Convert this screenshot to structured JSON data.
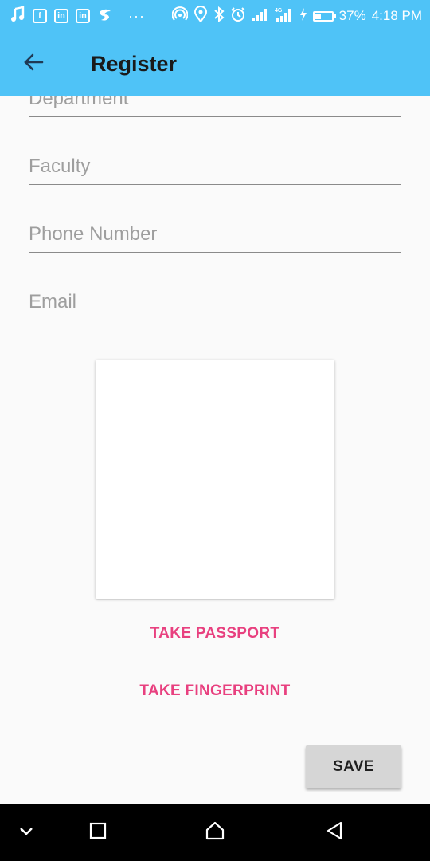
{
  "status_bar": {
    "icons_left": [
      "music-note-icon",
      "facebook-icon",
      "linkedin-icon",
      "linkedin-icon",
      "swirl-app-icon",
      "more-dots-icon"
    ],
    "icons_right": [
      "hotspot-icon",
      "location-icon",
      "bluetooth-icon",
      "alarm-icon",
      "signal-icon",
      "signal-4g-icon",
      "charging-icon",
      "battery-icon"
    ],
    "battery_level": 0.37,
    "battery_percent": "37%",
    "time": "4:18 PM"
  },
  "app_bar": {
    "title": "Register",
    "back_icon": "arrow-back-icon",
    "color": "#4fc3f7"
  },
  "form": {
    "fields": [
      {
        "name": "department",
        "placeholder": "Department"
      },
      {
        "name": "faculty",
        "placeholder": "Faculty"
      },
      {
        "name": "phone",
        "placeholder": "Phone Number"
      },
      {
        "name": "email",
        "placeholder": "Email"
      }
    ]
  },
  "actions": {
    "take_passport": "TAKE PASSPORT",
    "take_fingerprint": "TAKE FINGERPRINT",
    "save": "SAVE",
    "accent": "#e8407f"
  },
  "nav_bar": {
    "icons": [
      "chevron-down-icon",
      "recents-square-icon",
      "home-icon",
      "back-triangle-icon"
    ]
  }
}
